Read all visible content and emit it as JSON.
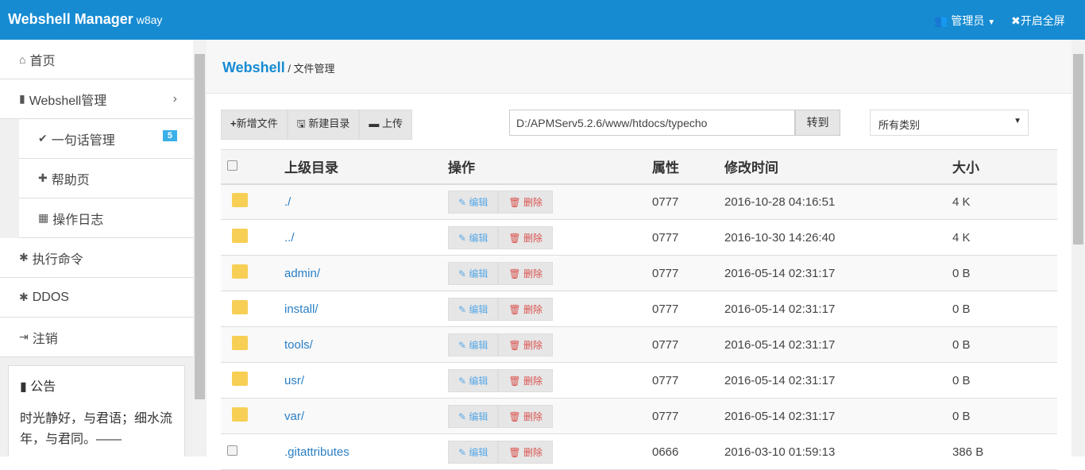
{
  "header": {
    "title": "Webshell Manager",
    "subtitle": "w8ay",
    "user": "管理员",
    "fullscreen": "开启全屏"
  },
  "sidebar": {
    "items": [
      {
        "label": "首页",
        "icon": "⌂",
        "name": "home"
      },
      {
        "label": "Webshell管理",
        "icon": "▮",
        "name": "webshell",
        "chev": "›"
      },
      {
        "label": "一句话管理",
        "icon": "✔",
        "name": "oneliner",
        "sub": true,
        "badge": "5"
      },
      {
        "label": "帮助页",
        "icon": "✚",
        "name": "help",
        "sub": true
      },
      {
        "label": "操作日志",
        "icon": "▦",
        "name": "log",
        "sub": true
      },
      {
        "label": "执行命令",
        "icon": "✱",
        "name": "exec"
      },
      {
        "label": "DDOS",
        "icon": "✱",
        "name": "ddos"
      },
      {
        "label": "注销",
        "icon": "⇥",
        "name": "logout"
      }
    ],
    "notice_title": "公告",
    "notice_text": "时光静好，与君语；细水流年，与君同。——"
  },
  "breadcrumb": {
    "root": "Webshell",
    "current": "/ 文件管理"
  },
  "toolbar": {
    "new_file": "新增文件",
    "new_dir": "新建目录",
    "upload": "上传",
    "path": "D:/APMServ5.2.6/www/htdocs/typecho",
    "go": "转到",
    "filter": "所有类别"
  },
  "table": {
    "headers": [
      "上级目录",
      "操作",
      "属性",
      "修改时间",
      "大小"
    ],
    "edit": "编辑",
    "delete": "删除",
    "rows": [
      {
        "type": "dir",
        "name": "./",
        "perm": "0777",
        "mtime": "2016-10-28 04:16:51",
        "size": "4 K"
      },
      {
        "type": "dir",
        "name": "../",
        "perm": "0777",
        "mtime": "2016-10-30 14:26:40",
        "size": "4 K"
      },
      {
        "type": "dir",
        "name": "admin/",
        "perm": "0777",
        "mtime": "2016-05-14 02:31:17",
        "size": "0 B"
      },
      {
        "type": "dir",
        "name": "install/",
        "perm": "0777",
        "mtime": "2016-05-14 02:31:17",
        "size": "0 B"
      },
      {
        "type": "dir",
        "name": "tools/",
        "perm": "0777",
        "mtime": "2016-05-14 02:31:17",
        "size": "0 B"
      },
      {
        "type": "dir",
        "name": "usr/",
        "perm": "0777",
        "mtime": "2016-05-14 02:31:17",
        "size": "0 B"
      },
      {
        "type": "dir",
        "name": "var/",
        "perm": "0777",
        "mtime": "2016-05-14 02:31:17",
        "size": "0 B"
      },
      {
        "type": "file",
        "name": ".gitattributes",
        "perm": "0666",
        "mtime": "2016-03-10 01:59:13",
        "size": "386 B"
      }
    ]
  }
}
